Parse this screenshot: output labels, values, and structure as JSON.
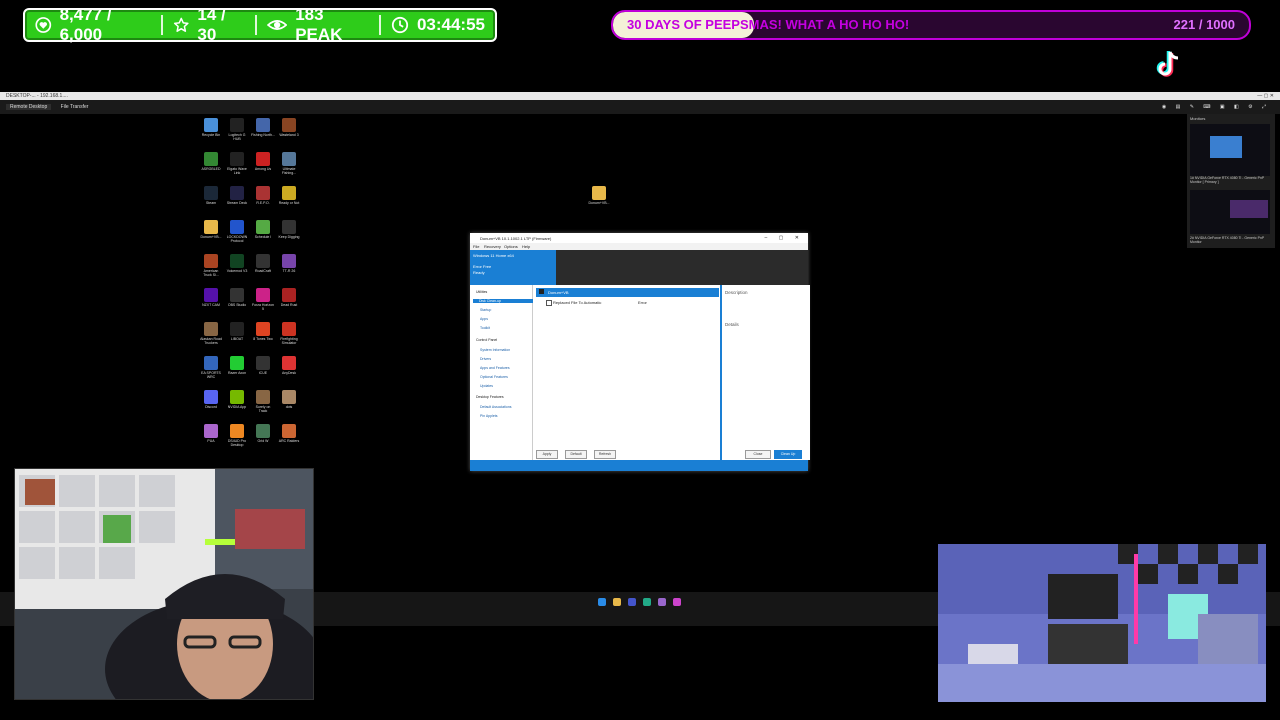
{
  "overlay": {
    "stats": {
      "followers": "8,477 / 6,000",
      "stars": "14 / 30",
      "viewers": "183 PEAK",
      "timer": "03:44:55"
    },
    "goal": {
      "title": "30 DAYS OF PEEPSMAS! WHAT A HO HO HO!",
      "count": "221 / 1000",
      "progress": 0.221
    }
  },
  "remote_desktop": {
    "window_title": "DESKTOP-... - 192.168.1.... ",
    "toolbar": {
      "tab_remote_desktop": "Remote Desktop",
      "tab_file_transfer": "File Transfer"
    },
    "monitors_panel": {
      "title": "Monitors",
      "monitor1": "1# NVIDIA GeForce RTX 4080 Ti - Generic PnP Monitor [ Primary ]",
      "monitor2": "2# NVIDIA GeForce RTX 4080 Ti - Generic PnP Monitor"
    },
    "desktop_icons": [
      {
        "label": "Recycle Bin",
        "color": "#4a90d9"
      },
      {
        "label": "Logitech G HUB",
        "color": "#222222"
      },
      {
        "label": "Fishing North...",
        "color": "#4466aa"
      },
      {
        "label": "Wasteland 3",
        "color": "#884422"
      },
      {
        "label": "ASRGBLED",
        "color": "#338833"
      },
      {
        "label": "Elgato Wave Link",
        "color": "#222222"
      },
      {
        "label": "Among Us",
        "color": "#cc2222"
      },
      {
        "label": "Ultimate Fishing...",
        "color": "#557799"
      },
      {
        "label": "Steam",
        "color": "#1b2838"
      },
      {
        "label": "Stream Deck",
        "color": "#222244"
      },
      {
        "label": "R.E.P.O.",
        "color": "#aa3333"
      },
      {
        "label": "Ready or Not",
        "color": "#ccaa22"
      },
      {
        "label": "Donum+VB...",
        "color": "#e8b84a"
      },
      {
        "label": "LOCKDOWN Protocol",
        "color": "#2255cc"
      },
      {
        "label": "Schedule I",
        "color": "#55aa44"
      },
      {
        "label": "Keep Digging",
        "color": "#333333"
      },
      {
        "label": "American Truck Si...",
        "color": "#aa4422"
      },
      {
        "label": "Voicemod V3",
        "color": "#114422"
      },
      {
        "label": "RoadCraft",
        "color": "#333333"
      },
      {
        "label": "TT-R 26",
        "color": "#7744aa"
      },
      {
        "label": "NZXT CAM",
        "color": "#5511aa"
      },
      {
        "label": "OBS Studio",
        "color": "#333333"
      },
      {
        "label": "Forza Horizon 5",
        "color": "#cc2288"
      },
      {
        "label": "Dead Rust",
        "color": "#aa2222"
      },
      {
        "label": "Alaskan Road Truckers",
        "color": "#886644"
      },
      {
        "label": "LIBOAT",
        "color": "#222222"
      },
      {
        "label": "8 Tones Two",
        "color": "#dd4422"
      },
      {
        "label": "Firefighting Simulator",
        "color": "#cc3322"
      },
      {
        "label": "EA SPORTS WRC",
        "color": "#3366bb"
      },
      {
        "label": "Razer Axon",
        "color": "#22cc33"
      },
      {
        "label": "iCUE",
        "color": "#333333"
      },
      {
        "label": "AnyDesk",
        "color": "#dd3333"
      },
      {
        "label": "Discord",
        "color": "#5865f2"
      },
      {
        "label": "NVIDIA App",
        "color": "#76b900"
      },
      {
        "label": "Surely on Track",
        "color": "#886644"
      },
      {
        "label": "dots",
        "color": "#aa8866"
      },
      {
        "label": "PUA",
        "color": "#aa66cc"
      },
      {
        "label": "DS4UD Pro Desktop",
        "color": "#ee8822"
      },
      {
        "label": "Grid W",
        "color": "#447755"
      },
      {
        "label": "ARC Raiders",
        "color": "#cc6633"
      }
    ],
    "folder_icon": {
      "label": "Donum+VB..."
    },
    "dialog": {
      "title": "Donum+VB 10.1.1002.1 LTP (Firmware)",
      "menu": [
        "File",
        "Recovery",
        "Options",
        "Help"
      ],
      "header_lines": [
        "Windows 11 Home x64",
        "Error Free",
        "Ready"
      ],
      "sidebar": {
        "group1": "Utilities",
        "items1": [
          "Disk Clean-up",
          "Startup",
          "Apps",
          "Toolkit"
        ],
        "group2": "Control Panel",
        "items2": [
          "System Information",
          "Drivers",
          "Apps and Features",
          "Optional Features",
          "Updates"
        ],
        "group3": "Desktop Features",
        "items3": [
          "Default Associations",
          "Pin Applets"
        ]
      },
      "list_header": "Donum+VB",
      "list_item": "Replaced File To Automatic",
      "list_item_value": "Error",
      "description_label": "Description",
      "details_label": "Details",
      "buttons_left": [
        "Apply",
        "Default",
        "Refresh"
      ],
      "buttons_right": [
        "Close",
        "Clean Up"
      ]
    }
  }
}
